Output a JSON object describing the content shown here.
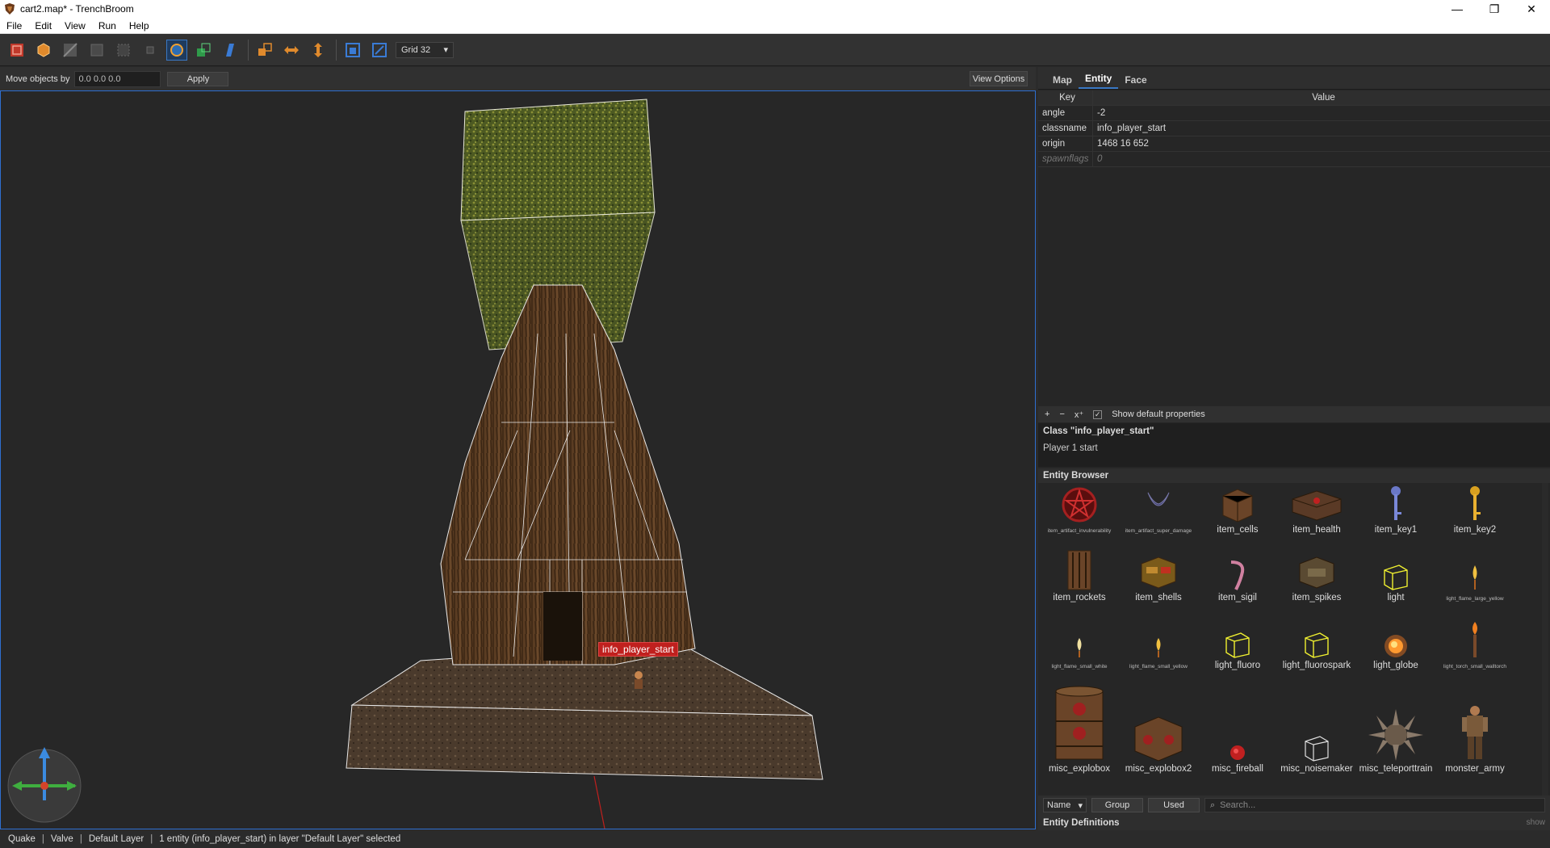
{
  "window": {
    "title": "cart2.map* - TrenchBroom",
    "minimize": "—",
    "maximize": "❐",
    "close": "✕"
  },
  "menu": [
    "File",
    "Edit",
    "View",
    "Run",
    "Help"
  ],
  "toolbar": {
    "grid_label": "Grid 32"
  },
  "movebar": {
    "label": "Move objects by",
    "value": "0.0 0.0 0.0",
    "apply": "Apply",
    "view_options": "View Options"
  },
  "viewport": {
    "selected_label": "info_player_start"
  },
  "statusbar": {
    "game": "Quake",
    "format": "Valve",
    "layer": "Default Layer",
    "message": "1 entity (info_player_start) in layer \"Default Layer\" selected"
  },
  "inspector": {
    "tabs": [
      "Map",
      "Entity",
      "Face"
    ],
    "active_tab": "Entity",
    "columns": {
      "key": "Key",
      "value": "Value"
    },
    "properties": [
      {
        "key": "angle",
        "value": "-2"
      },
      {
        "key": "classname",
        "value": "info_player_start"
      },
      {
        "key": "origin",
        "value": "1468 16 652"
      },
      {
        "key": "spawnflags",
        "value": "0",
        "default": true
      }
    ],
    "tools": {
      "add": "+",
      "remove": "−",
      "clear": "x⁺",
      "show_default": "Show default properties"
    },
    "class_title": "Class \"info_player_start\"",
    "class_desc": "Player 1 start"
  },
  "entity_browser": {
    "title": "Entity Browser",
    "items": [
      {
        "name": "item_artifact_invulnerability",
        "tiny": true,
        "icon": "pentagram-icon"
      },
      {
        "name": "item_artifact_super_damage",
        "tiny": true,
        "icon": "quad-icon"
      },
      {
        "name": "item_cells",
        "icon": "crate-icon"
      },
      {
        "name": "item_health",
        "icon": "health-icon"
      },
      {
        "name": "item_key1",
        "icon": "key-silver-icon"
      },
      {
        "name": "item_key2",
        "icon": "key-gold-icon"
      },
      {
        "name": "item_rockets",
        "icon": "rockets-icon"
      },
      {
        "name": "item_shells",
        "icon": "shells-icon"
      },
      {
        "name": "item_sigil",
        "icon": "sigil-icon"
      },
      {
        "name": "item_spikes",
        "icon": "spikes-icon"
      },
      {
        "name": "light",
        "icon": "wire-cube-icon"
      },
      {
        "name": "light_flame_large_yellow",
        "tiny": true,
        "icon": "flame-icon"
      },
      {
        "name": "light_flame_small_white",
        "tiny": true,
        "icon": "flame-icon"
      },
      {
        "name": "light_flame_small_yellow",
        "tiny": true,
        "icon": "flame-icon"
      },
      {
        "name": "light_fluoro",
        "icon": "wire-cube-icon"
      },
      {
        "name": "light_fluorospark",
        "icon": "wire-cube-icon"
      },
      {
        "name": "light_globe",
        "icon": "globe-icon"
      },
      {
        "name": "light_torch_small_walltorch",
        "tiny": true,
        "icon": "torch-icon"
      },
      {
        "name": "misc_explobox",
        "icon": "barrel-icon"
      },
      {
        "name": "misc_explobox2",
        "icon": "barrel-small-icon"
      },
      {
        "name": "misc_fireball",
        "icon": "fireball-icon"
      },
      {
        "name": "misc_noisemaker",
        "icon": "wire-cube-icon"
      },
      {
        "name": "misc_teleporttrain",
        "icon": "spikeball-icon"
      },
      {
        "name": "monster_army",
        "icon": "soldier-icon"
      }
    ],
    "sort": "Name",
    "group": "Group",
    "used": "Used",
    "search_placeholder": "Search..."
  },
  "entity_definitions": {
    "title": "Entity Definitions",
    "toggle": "show"
  }
}
